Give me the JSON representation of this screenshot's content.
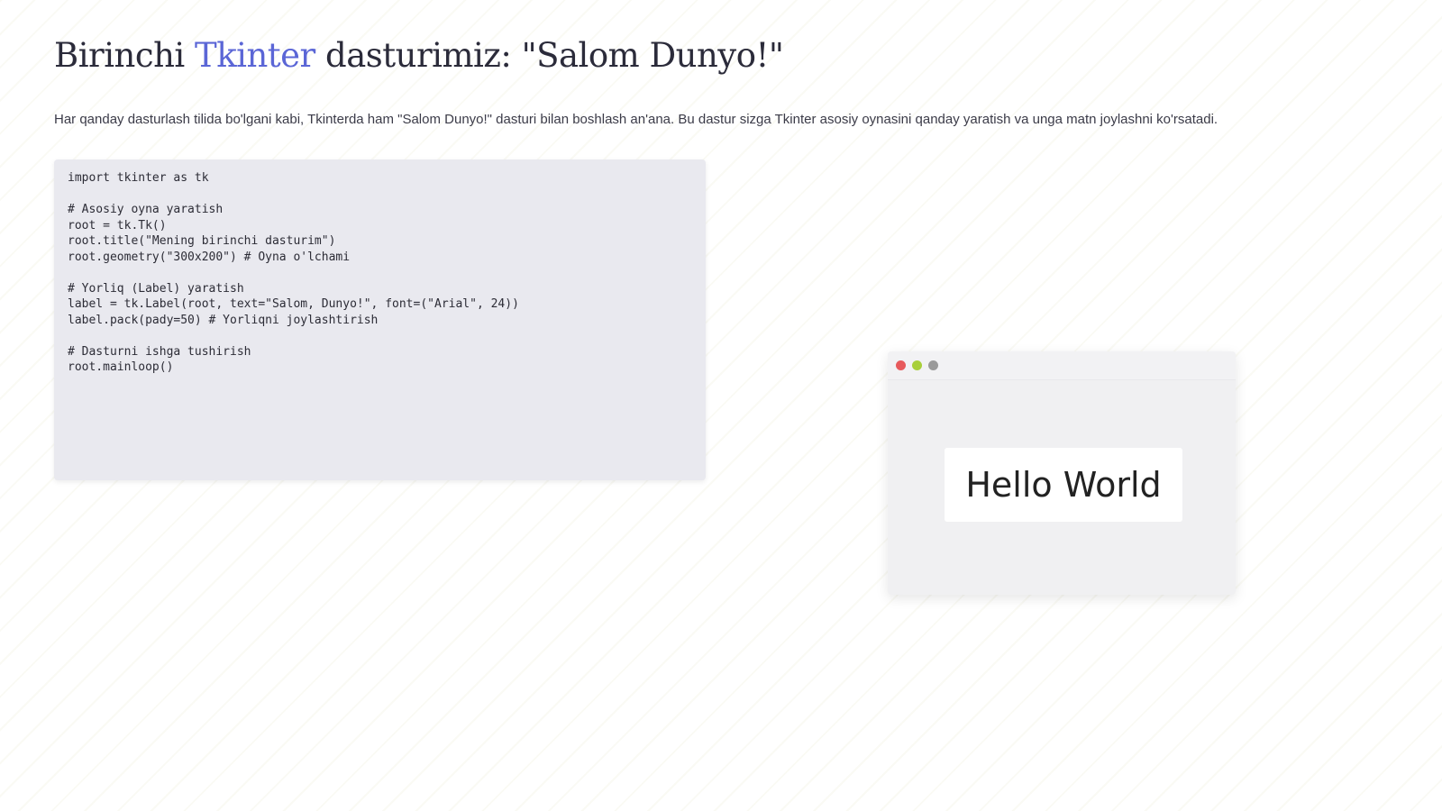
{
  "title": {
    "prefix": "Birinchi ",
    "accent": "Tkinter",
    "suffix": " dasturimiz: \"Salom Dunyo!\""
  },
  "intro": "Har qanday dasturlash tilida bo'lgani kabi, Tkinterda ham \"Salom Dunyo!\" dasturi bilan boshlash an'ana. Bu dastur sizga Tkinter asosiy oynasini qanday yaratish va unga matn joylashni ko'rsatadi.",
  "code": "import tkinter as tk\n\n# Asosiy oyna yaratish\nroot = tk.Tk()\nroot.title(\"Mening birinchi dasturim\")\nroot.geometry(\"300x200\") # Oyna o'lchami\n\n# Yorliq (Label) yaratish\nlabel = tk.Label(root, text=\"Salom, Dunyo!\", font=(\"Arial\", 24))\nlabel.pack(pady=50) # Yorliqni joylashtirish\n\n# Dasturni ishga tushirish\nroot.mainloop()",
  "window_preview": {
    "label_text": "Hello World",
    "controls": [
      "close",
      "minimize",
      "zoom"
    ]
  },
  "colors": {
    "accent": "#5b66d6",
    "code_bg": "#e9e9ef",
    "close": "#e75a5c",
    "minimize": "#a8cf3a",
    "zoom": "#9a9a9a"
  }
}
